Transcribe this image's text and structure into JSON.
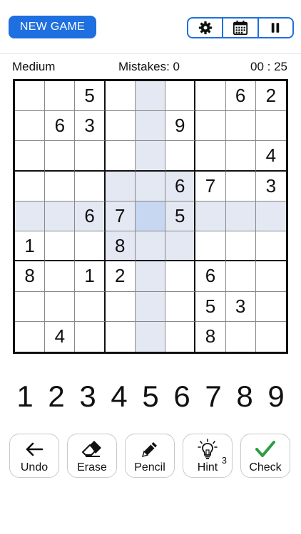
{
  "header": {
    "new_game_label": "NEW GAME",
    "controls": [
      "gear-icon",
      "calendar-icon",
      "pause-icon"
    ]
  },
  "status": {
    "difficulty": "Medium",
    "mistakes": "Mistakes: 0",
    "timer": "00 : 25"
  },
  "board": {
    "rows": [
      [
        "",
        "",
        "5",
        "",
        "",
        "",
        "",
        "6",
        "2"
      ],
      [
        "",
        "6",
        "3",
        "",
        "",
        "9",
        "",
        "",
        ""
      ],
      [
        "",
        "",
        "",
        "",
        "",
        "",
        "",
        "",
        "4"
      ],
      [
        "",
        "",
        "",
        "",
        "",
        "6",
        "7",
        "",
        "3"
      ],
      [
        "",
        "",
        "6",
        "7",
        "",
        "5",
        "",
        "",
        ""
      ],
      [
        "1",
        "",
        "",
        "8",
        "",
        "",
        "",
        "",
        ""
      ],
      [
        "8",
        "",
        "1",
        "2",
        "",
        "",
        "6",
        "",
        ""
      ],
      [
        "",
        "",
        "",
        "",
        "",
        "",
        "5",
        "3",
        ""
      ],
      [
        "",
        "4",
        "",
        "",
        "",
        "",
        "8",
        "",
        ""
      ]
    ],
    "selected": {
      "row": 4,
      "col": 4
    }
  },
  "numpad": [
    "1",
    "2",
    "3",
    "4",
    "5",
    "6",
    "7",
    "8",
    "9"
  ],
  "tools": [
    {
      "label": "Undo",
      "icon": "undo-arrow-icon"
    },
    {
      "label": "Erase",
      "icon": "eraser-icon"
    },
    {
      "label": "Pencil",
      "icon": "pencil-icon"
    },
    {
      "label": "Hint",
      "icon": "lightbulb-icon",
      "count": "3"
    },
    {
      "label": "Check",
      "icon": "checkmark-icon"
    }
  ],
  "colors": {
    "accent": "#1E6FE0",
    "highlight": "#E3E8F3",
    "selected": "#C7D7F1",
    "check": "#2E9E44"
  }
}
